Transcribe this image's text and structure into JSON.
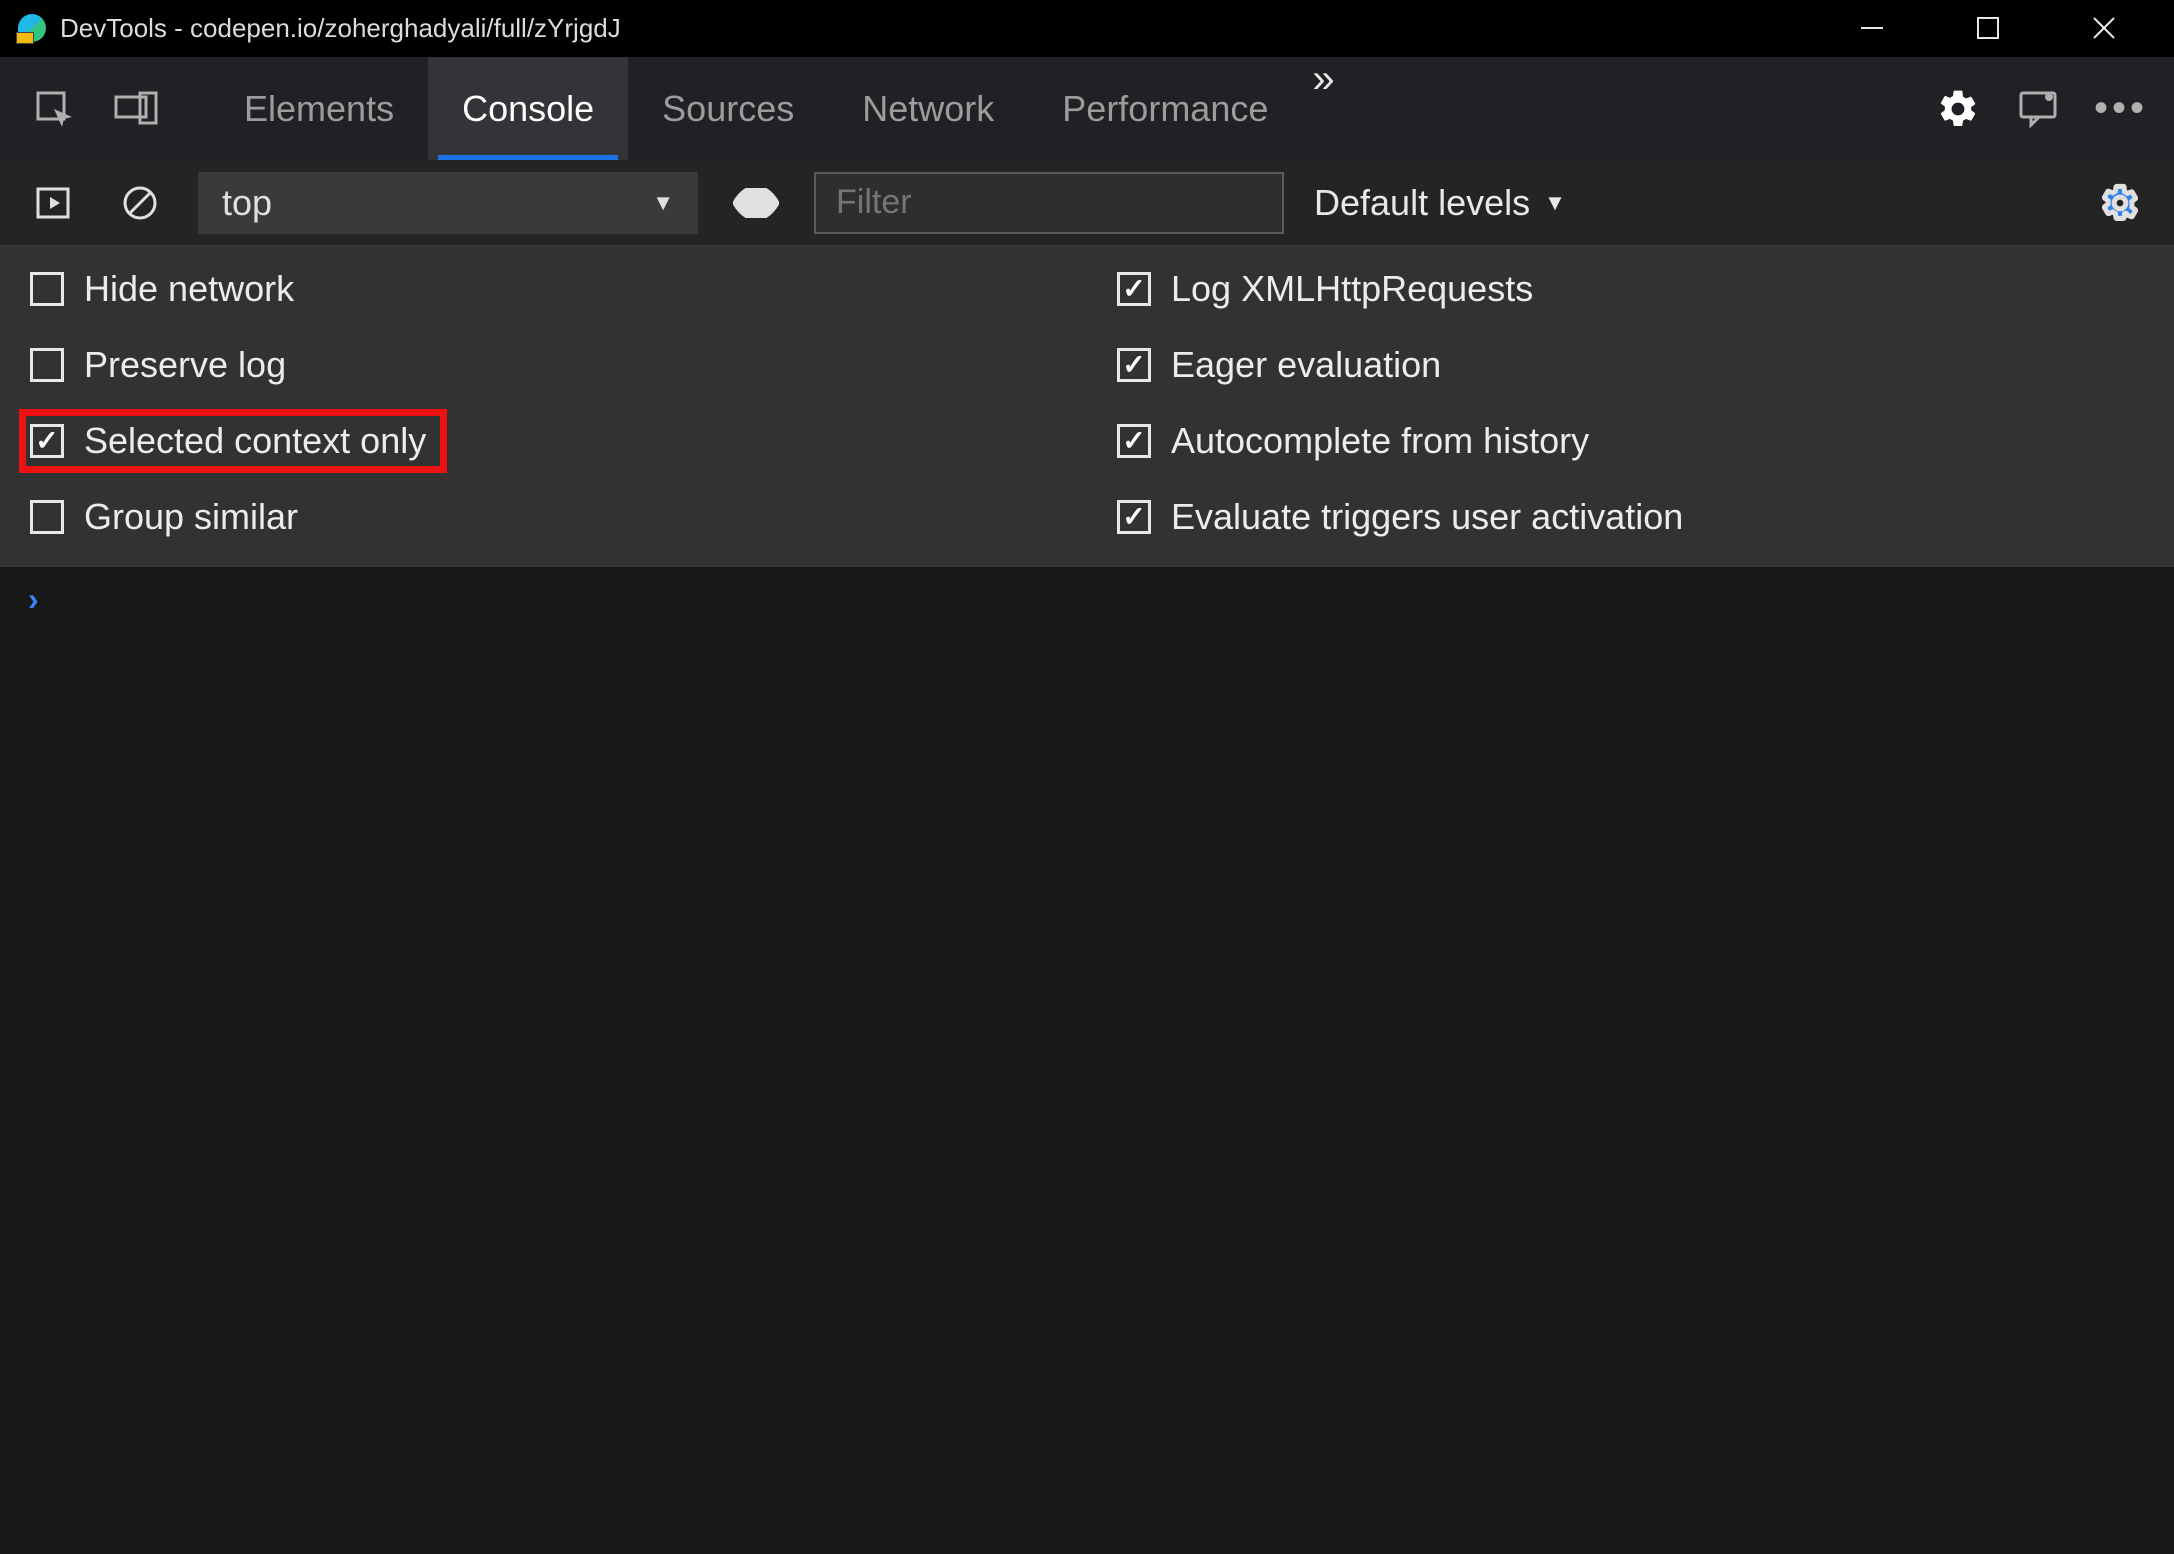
{
  "window": {
    "title": "DevTools - codepen.io/zoherghadyali/full/zYrjgdJ"
  },
  "tabs": {
    "items": [
      "Elements",
      "Console",
      "Sources",
      "Network",
      "Performance"
    ],
    "active": "Console"
  },
  "toolbar": {
    "context": "top",
    "filter_placeholder": "Filter",
    "levels": "Default levels"
  },
  "settings": {
    "left": [
      {
        "label": "Hide network",
        "checked": false
      },
      {
        "label": "Preserve log",
        "checked": false
      },
      {
        "label": "Selected context only",
        "checked": true,
        "highlight": true
      },
      {
        "label": "Group similar",
        "checked": false
      }
    ],
    "right": [
      {
        "label": "Log XMLHttpRequests",
        "checked": true
      },
      {
        "label": "Eager evaluation",
        "checked": true
      },
      {
        "label": "Autocomplete from history",
        "checked": true
      },
      {
        "label": "Evaluate triggers user activation",
        "checked": true
      }
    ]
  }
}
